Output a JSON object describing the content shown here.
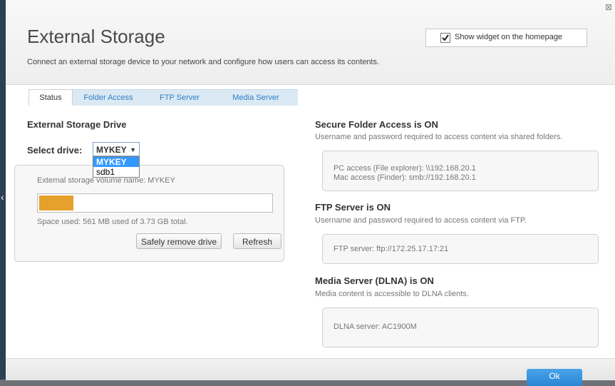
{
  "window": {
    "close_glyph": "⊠"
  },
  "header": {
    "title": "External Storage",
    "subtitle": "Connect an external storage device to your network and configure how users can access its contents.",
    "widget_label": "Show widget on the homepage",
    "widget_checked": true
  },
  "tabs": [
    {
      "label": "Status",
      "active": true
    },
    {
      "label": "Folder Access",
      "active": false
    },
    {
      "label": "FTP Server",
      "active": false
    },
    {
      "label": "Media Server",
      "active": false
    }
  ],
  "left": {
    "section_title": "External Storage Drive",
    "select_label": "Select drive:",
    "selected_drive": "MYKEY",
    "arrow_glyph": "▼",
    "drive_options": [
      "MYKEY",
      "sdb1"
    ],
    "volume_name": "External storage volume name: MYKEY",
    "usage_fraction": 0.147,
    "space_used": "Space used: 561 MB used of 3.73 GB total.",
    "remove_button": "Safely remove drive",
    "refresh_button": "Refresh"
  },
  "right": {
    "secure": {
      "title": "Secure Folder Access is ON",
      "description": "Username and password required to access content via shared folders.",
      "pc_access": "PC access (File explorer): \\\\192.168.20.1",
      "mac_access": "Mac access (Finder): smb://192.168.20.1"
    },
    "ftp": {
      "title": "FTP Server is ON",
      "description": "Username and password required to access content via FTP.",
      "server": "FTP server: ftp://172.25.17.17:21"
    },
    "media": {
      "title": "Media Server (DLNA) is ON",
      "description": "Media content is accessible to DLNA clients.",
      "server": "DLNA server: AC1900M"
    }
  },
  "footer": {
    "ok_label": "Ok"
  },
  "colors": {
    "accent": "#2d7fc4",
    "usage_bar": "#e6a02c",
    "ok_button": "#3a95de",
    "dropdown_highlight": "#3399ff"
  }
}
